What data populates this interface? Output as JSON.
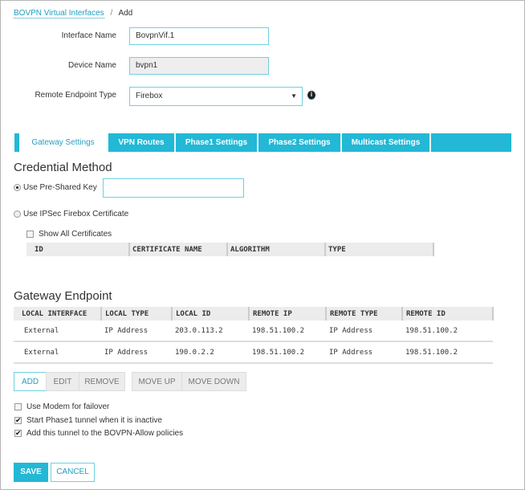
{
  "breadcrumb": {
    "parent": "BOVPN Virtual Interfaces",
    "separator": "/",
    "current": "Add"
  },
  "form": {
    "interface_name": {
      "label": "Interface Name",
      "value": "BovpnVif.1"
    },
    "device_name": {
      "label": "Device Name",
      "value": "bvpn1"
    },
    "remote_endpoint_type": {
      "label": "Remote Endpoint Type",
      "value": "Firebox"
    }
  },
  "tabs": [
    {
      "label": "Gateway Settings",
      "active": true
    },
    {
      "label": "VPN Routes"
    },
    {
      "label": "Phase1 Settings"
    },
    {
      "label": "Phase2 Settings"
    },
    {
      "label": "Multicast Settings"
    }
  ],
  "credential": {
    "title": "Credential Method",
    "psk_label": "Use Pre-Shared Key",
    "psk_value": "",
    "cert_label": "Use IPSec Firebox Certificate",
    "show_all_label": "Show All Certificates",
    "columns": [
      "ID",
      "CERTIFICATE NAME",
      "ALGORITHM",
      "TYPE"
    ]
  },
  "gateway": {
    "title": "Gateway Endpoint",
    "columns": [
      "LOCAL INTERFACE",
      "LOCAL TYPE",
      "LOCAL ID",
      "REMOTE IP",
      "REMOTE TYPE",
      "REMOTE ID"
    ],
    "rows": [
      [
        "External",
        "IP Address",
        "203.0.113.2",
        "198.51.100.2",
        "IP Address",
        "198.51.100.2"
      ],
      [
        "External",
        "IP Address",
        "190.0.2.2",
        "198.51.100.2",
        "IP Address",
        "198.51.100.2"
      ]
    ],
    "buttons": {
      "add": "ADD",
      "edit": "EDIT",
      "remove": "REMOVE",
      "move_up": "MOVE UP",
      "move_down": "MOVE DOWN"
    }
  },
  "options": [
    {
      "label": "Use Modem for failover",
      "checked": false
    },
    {
      "label": "Start Phase1 tunnel when it is inactive",
      "checked": true
    },
    {
      "label": "Add this tunnel to the BOVPN-Allow policies",
      "checked": true
    }
  ],
  "footer": {
    "save": "SAVE",
    "cancel": "CANCEL"
  },
  "colors": {
    "accent": "#22b8d6"
  }
}
